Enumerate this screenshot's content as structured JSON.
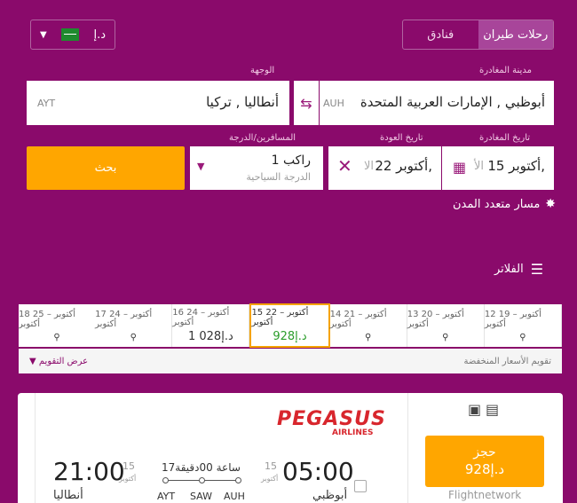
{
  "tabs": [
    {
      "label": "رحلات طيران",
      "active": true
    },
    {
      "label": "فنادق",
      "active": false
    }
  ],
  "currency": {
    "label": "د.إ",
    "flag_text": "SAR"
  },
  "origin": {
    "label": "مدينة المغادرة",
    "value": "أبوظبي , الإمارات العربية المتحدة",
    "code": "AUH"
  },
  "destination": {
    "label": "الوجهة",
    "value": "أنطاليا , تركيا",
    "code": "AYT"
  },
  "depart_date": {
    "label": "تاريخ المغادرة",
    "value": "15 أكتوبر,",
    "hint": "الأ"
  },
  "return_date": {
    "label": "تاريخ العودة",
    "value": "22 أكتوبر,",
    "hint": "الا"
  },
  "passengers": {
    "label": "المسافرين/الدرجة",
    "value": "1 راكب",
    "class": "الدرجة السياحية"
  },
  "search_button": "بحث",
  "multi_city": "مسار متعدد المدن",
  "filters": "الفلاتر",
  "calendar": [
    {
      "dates": "12 أكتوبر – 19 أكتوبر",
      "price": ""
    },
    {
      "dates": "13 أكتوبر – 20 أكتوبر",
      "price": ""
    },
    {
      "dates": "14 أكتوبر – 21 أكتوبر",
      "price": ""
    },
    {
      "dates": "15 أكتوبر – 22 أكتوبر",
      "price": "928د.إ",
      "selected": true
    },
    {
      "dates": "16 أكتوبر – 24 أكتوبر",
      "price": "1 028د.إ"
    },
    {
      "dates": "17 أكتوبر – 24 أكتوبر",
      "price": ""
    },
    {
      "dates": "18 أكتوبر – 25 أكتوبر",
      "price": ""
    }
  ],
  "calendar_footer": {
    "left": "تقويم الأسعار المنخفضة",
    "right": "عرض التقويم"
  },
  "flight": {
    "airline": "PEGASUS",
    "airline_sub": "AIRLINES",
    "dep_time": "05:00",
    "dep_day": "15",
    "dep_month": "أكتوبر",
    "dep_city": "أبوظبي",
    "arr_time": "21:00",
    "arr_day": "15",
    "arr_month": "أكتوبر",
    "arr_city": "أنطاليا",
    "duration": "17ساعة 00دقيقة",
    "stops": [
      "AUH",
      "SAW",
      "AYT"
    ],
    "book_label": "حجز",
    "book_price": "928د.إ",
    "provider": "Flightnetwork"
  },
  "colors": {
    "brand": "#8a0a6b",
    "accent": "#ffa600",
    "price_green": "#2a9d2a"
  }
}
